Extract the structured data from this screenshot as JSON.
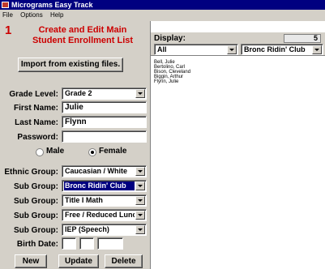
{
  "window": {
    "title": "Micrograms Easy Track"
  },
  "menu": [
    "File",
    "Options",
    "Help"
  ],
  "step": {
    "number": "1",
    "heading_line1": "Create and Edit Main",
    "heading_line2": "Student Enrollment List"
  },
  "import_button": "Import from existing files.",
  "form": {
    "grade_level": {
      "label": "Grade Level:",
      "value": "Grade 2"
    },
    "first_name": {
      "label": "First Name:",
      "value": "Julie"
    },
    "last_name": {
      "label": "Last Name:",
      "value": "Flynn"
    },
    "password": {
      "label": "Password:",
      "value": ""
    },
    "gender": {
      "male": "Male",
      "female": "Female",
      "selected": "Female"
    },
    "ethnic_group": {
      "label": "Ethnic Group:",
      "value": "Caucasian / White"
    },
    "sub_groups": [
      {
        "label": "Sub Group:",
        "value": "Bronc Ridin' Club",
        "selected": true
      },
      {
        "label": "Sub Group:",
        "value": "Title I Math",
        "selected": false
      },
      {
        "label": "Sub Group:",
        "value": "Free / Reduced Lunch",
        "selected": false
      },
      {
        "label": "Sub Group:",
        "value": "IEP (Speech)",
        "selected": false
      }
    ],
    "birth_date": {
      "label": "Birth Date:",
      "month": "",
      "day": "",
      "year": ""
    }
  },
  "buttons": {
    "new": "New",
    "update": "Update",
    "delete": "Delete"
  },
  "display": {
    "title": "Display:",
    "count": "5",
    "filter_left": "All",
    "filter_right": "Bronc Ridin' Club",
    "students": [
      "Bell, Julie",
      "Bertolino, Carl",
      "Bison, Cleveland",
      "Biggin, Arthur",
      "Flynn, Julie"
    ]
  },
  "colors": {
    "accent_red": "#cc0000",
    "titlebar": "#000080",
    "chrome": "#d4d0c8"
  }
}
